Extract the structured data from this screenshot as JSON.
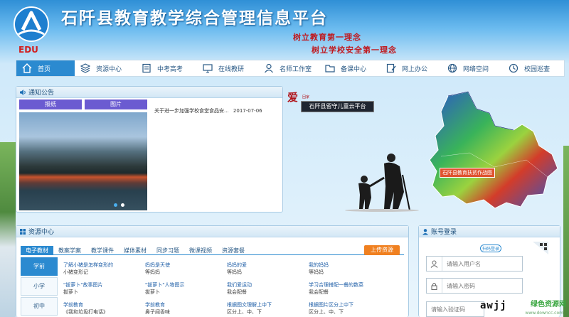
{
  "header": {
    "title": "石阡县教育教学综合管理信息平台",
    "slogan1": "树立教育第一理念",
    "slogan2": "树立学校安全第一理念",
    "logo_text": "EDU"
  },
  "nav": {
    "items": [
      {
        "label": "首页",
        "icon": "home-icon"
      },
      {
        "label": "资源中心",
        "icon": "layers-icon"
      },
      {
        "label": "中考高考",
        "icon": "book-icon"
      },
      {
        "label": "在线教研",
        "icon": "monitor-icon"
      },
      {
        "label": "名师工作室",
        "icon": "user-icon"
      },
      {
        "label": "备课中心",
        "icon": "folder-icon"
      },
      {
        "label": "网上办公",
        "icon": "edit-icon"
      },
      {
        "label": "网络空间",
        "icon": "globe-icon"
      },
      {
        "label": "校园巡查",
        "icon": "clock-icon"
      }
    ]
  },
  "notice": {
    "title": "通知公告",
    "tab1": "报纸",
    "tab2": "图片",
    "news": [
      {
        "text": "关于进一步加强学校食堂食品安...",
        "date": "2017-07-06"
      }
    ]
  },
  "promo": {
    "ai": "爱",
    "ai_sub": "回家",
    "label": "石阡县留守儿童云平台"
  },
  "map": {
    "label": "石阡县教育扶贫作战图",
    "colors": {
      "high": "#d33c2a",
      "mid": "#39b35a",
      "low": "#2c56c9"
    }
  },
  "resource": {
    "title": "资源中心",
    "upload": "上传资源",
    "tabs": [
      "电子教材",
      "教案学案",
      "教学课件",
      "媒体素材",
      "同步习题",
      "微课视频",
      "资源套餐"
    ],
    "side": [
      "学前",
      "小学",
      "初中"
    ],
    "rows": [
      [
        {
          "title": "了解小猪是怎样变形的",
          "author": "小猪变形记"
        },
        {
          "title": "妈妈是天使",
          "author": "等妈妈"
        },
        {
          "title": "妈妈的爱",
          "author": "等妈妈"
        },
        {
          "title": "我的妈妈",
          "author": "等妈妈"
        }
      ],
      [
        {
          "title": "\"拔萝卜\"故事图片",
          "author": "拔萝卜"
        },
        {
          "title": "\"拔萝卜\"人物图示",
          "author": "拔萝卜"
        },
        {
          "title": "我们爱运动",
          "author": "我会配餐"
        },
        {
          "title": "学习合理搭配一餐的数菜",
          "author": "我会配餐"
        }
      ],
      [
        {
          "title": "学前教育",
          "author": "《我和垃圾打电话》"
        },
        {
          "title": "学前教育",
          "author": "鼻子闻香味"
        },
        {
          "title": "根据图文理解上中下",
          "author": "区分上、中、下"
        },
        {
          "title": "根据图片区分上中下",
          "author": "区分上、中、下"
        }
      ]
    ]
  },
  "login": {
    "title": "账号登录",
    "scan": "扫码登录",
    "username_placeholder": "请输入用户名",
    "password_placeholder": "请输入密码",
    "captcha_placeholder": "请输入验证码",
    "captcha_text": "awjj"
  },
  "watermark": {
    "text": "绿色资源网",
    "sub": "www.downcc.com"
  }
}
